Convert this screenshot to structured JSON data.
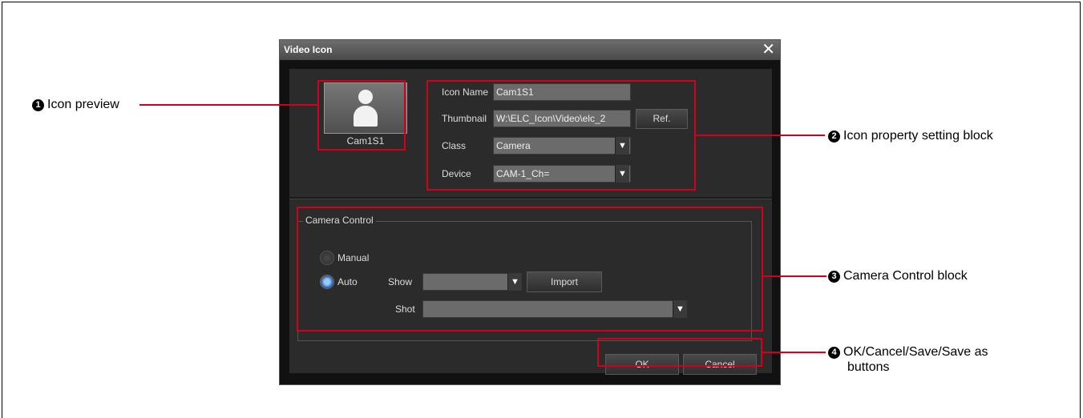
{
  "dialog": {
    "title": "Video Icon",
    "close_icon": "close-icon",
    "preview": {
      "icon": "person-icon",
      "label": "Cam1S1"
    },
    "properties": {
      "icon_name_label": "Icon Name",
      "icon_name_value": "Cam1S1",
      "thumbnail_label": "Thumbnail",
      "thumbnail_value": "W:\\ELC_Icon\\Video\\elc_2",
      "ref_button": "Ref.",
      "class_label": "Class",
      "class_value": "Camera",
      "device_label": "Device",
      "device_value": "CAM-1_Ch="
    },
    "camera_control": {
      "group_label": "Camera Control",
      "manual_label": "Manual",
      "auto_label": "Auto",
      "auto_selected": true,
      "show_label": "Show",
      "show_value": "",
      "import_button": "Import",
      "shot_label": "Shot",
      "shot_value": ""
    },
    "buttons": {
      "ok": "OK",
      "cancel": "Cancel"
    }
  },
  "callouts": {
    "c1": {
      "num": "1",
      "text": "Icon preview"
    },
    "c2": {
      "num": "2",
      "text": "Icon property setting block"
    },
    "c3": {
      "num": "3",
      "text": "Camera Control block"
    },
    "c4": {
      "num": "4",
      "text": "OK/Cancel/Save/Save as",
      "text2": "buttons"
    }
  },
  "colors": {
    "highlight": "#d0021b",
    "dialog_bg": "#2b2b2b",
    "radio_on": "#3b6fb8"
  }
}
